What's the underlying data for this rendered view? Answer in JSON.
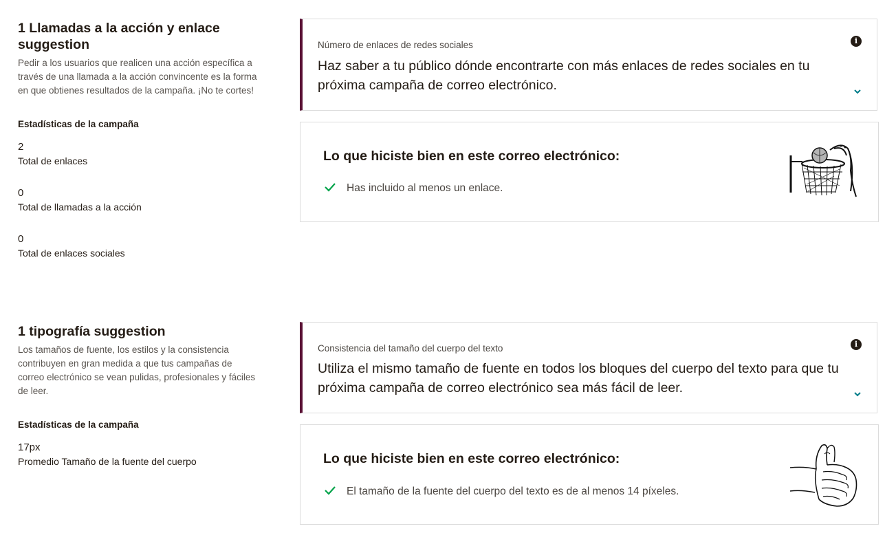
{
  "sections": [
    {
      "title": "1 Llamadas a la acción y enlace suggestion",
      "description": "Pedir a los usuarios que realicen una acción específica a través de una llamada a la acción convincente es la forma en que obtienes resultados de la campaña. ¡No te cortes!",
      "stats_heading": "Estadísticas de la campaña",
      "stats": [
        {
          "value": "2",
          "label": "Total de enlaces"
        },
        {
          "value": "0",
          "label": "Total de llamadas a la acción"
        },
        {
          "value": "0",
          "label": "Total de enlaces sociales"
        }
      ],
      "suggestion": {
        "label": "Número de enlaces de redes sociales",
        "text": "Haz saber a tu público dónde encontrarte con más enlaces de redes sociales en tu próxima campaña de correo electrónico."
      },
      "good": {
        "title": "Lo que hiciste bien en este correo electrónico:",
        "item": "Has incluido al menos un enlace.",
        "illustration": "basketball-hoop-illustration"
      }
    },
    {
      "title": "1 tipografía suggestion",
      "description": "Los tamaños de fuente, los estilos y la consistencia contribuyen en gran medida a que tus campañas de correo electrónico se vean pulidas, profesionales y fáciles de leer.",
      "stats_heading": "Estadísticas de la campaña",
      "stats": [
        {
          "value": "17px",
          "label": "Promedio Tamaño de la fuente del cuerpo"
        }
      ],
      "suggestion": {
        "label": "Consistencia del tamaño del cuerpo del texto",
        "text": "Utiliza el mismo tamaño de fuente en todos los bloques del cuerpo del texto para que tu próxima campaña de correo electrónico sea más fácil de leer."
      },
      "good": {
        "title": "Lo que hiciste bien en este correo electrónico:",
        "item": "El tamaño de la fuente del cuerpo del texto es de al menos 14 píxeles.",
        "illustration": "thumbs-up-hands-illustration"
      }
    }
  ],
  "icons": {
    "info": "info-icon",
    "chevron": "chevron-down-icon",
    "check": "check-icon"
  },
  "colors": {
    "accent_border": "#5a1235",
    "check": "#00a34a",
    "chevron": "#007c89"
  }
}
